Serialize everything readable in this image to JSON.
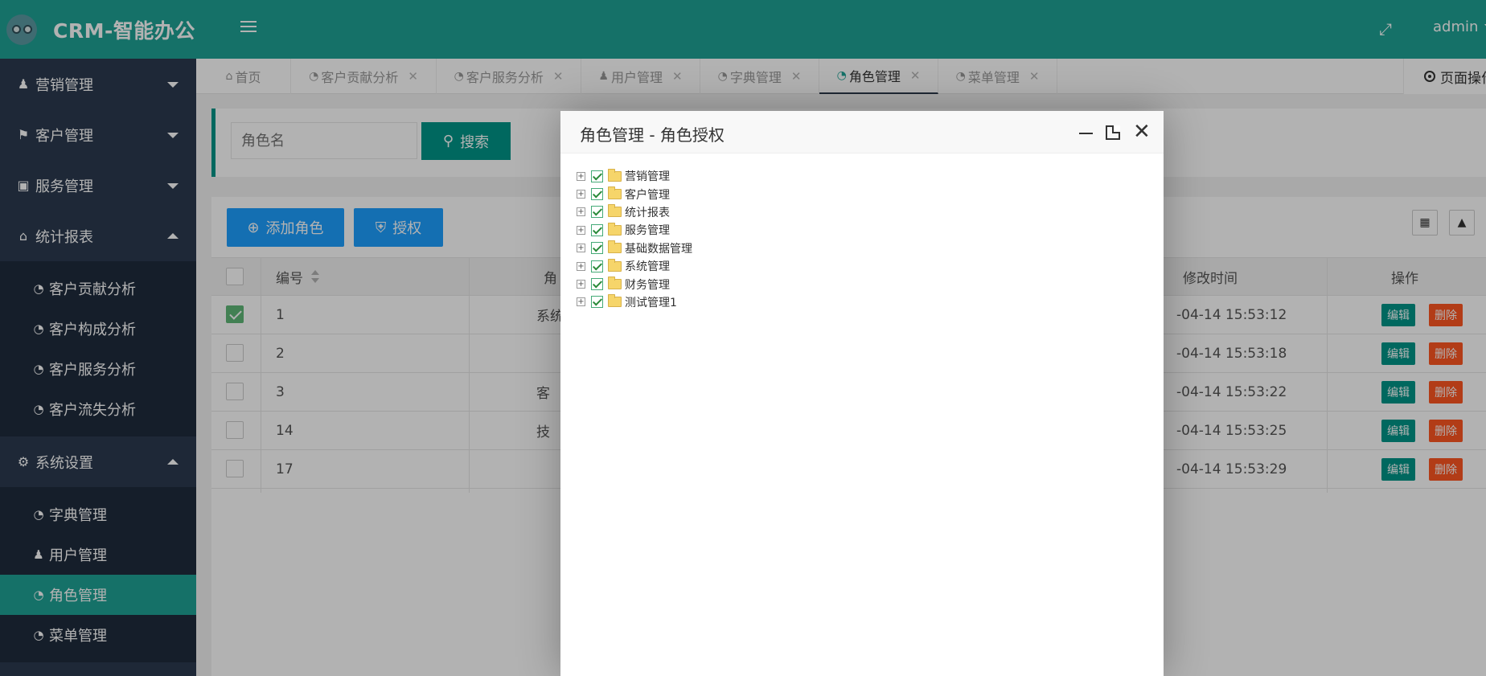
{
  "app": {
    "title": "CRM-智能办公"
  },
  "header": {
    "user": "admin"
  },
  "sidebar": {
    "groups": [
      {
        "label": "营销管理",
        "icon": "user-tie-icon",
        "open": false
      },
      {
        "label": "客户管理",
        "icon": "flag-icon",
        "open": false
      },
      {
        "label": "服务管理",
        "icon": "desktop-icon",
        "open": false
      },
      {
        "label": "统计报表",
        "icon": "home-icon",
        "open": true,
        "items": [
          "客户贡献分析",
          "客户构成分析",
          "客户服务分析",
          "客户流失分析"
        ]
      },
      {
        "label": "系统设置",
        "icon": "gears-icon",
        "open": true,
        "items": [
          "字典管理",
          "用户管理",
          "角色管理",
          "菜单管理"
        ]
      }
    ]
  },
  "tabs": [
    {
      "label": "首页",
      "closable": false
    },
    {
      "label": "客户贡献分析",
      "closable": true
    },
    {
      "label": "客户服务分析",
      "closable": true
    },
    {
      "label": "用户管理",
      "closable": true
    },
    {
      "label": "字典管理",
      "closable": true
    },
    {
      "label": "角色管理",
      "closable": true,
      "active": true
    },
    {
      "label": "菜单管理",
      "closable": true
    }
  ],
  "page_ops": "页面操作",
  "search": {
    "placeholder": "角色名",
    "button": "搜索"
  },
  "toolbar": {
    "add": "添加角色",
    "grant": "授权"
  },
  "table": {
    "headers": {
      "id": "编号",
      "name": "角",
      "updated": "修改时间",
      "actions": "操作"
    },
    "rows": [
      {
        "id": "1",
        "name": "系统",
        "updated": "-04-14 15:53:12",
        "checked": true
      },
      {
        "id": "2",
        "name": "",
        "updated": "-04-14 15:53:18",
        "checked": false
      },
      {
        "id": "3",
        "name": "客",
        "updated": "-04-14 15:53:22",
        "checked": false
      },
      {
        "id": "14",
        "name": "技",
        "updated": "-04-14 15:53:25",
        "checked": false
      },
      {
        "id": "17",
        "name": "",
        "updated": "-04-14 15:53:29",
        "checked": false
      }
    ],
    "edit_label": "编辑",
    "delete_label": "删除"
  },
  "modal": {
    "title": "角色管理 - 角色授权",
    "tree": [
      "营销管理",
      "客户管理",
      "统计报表",
      "服务管理",
      "基础数据管理",
      "系统管理",
      "财务管理",
      "测试管理1"
    ]
  },
  "colors": {
    "brand": "#1fa295",
    "sidebar": "#2b3a4f",
    "primary": "#009688",
    "blue": "#1e9fff",
    "danger": "#ff5722"
  }
}
